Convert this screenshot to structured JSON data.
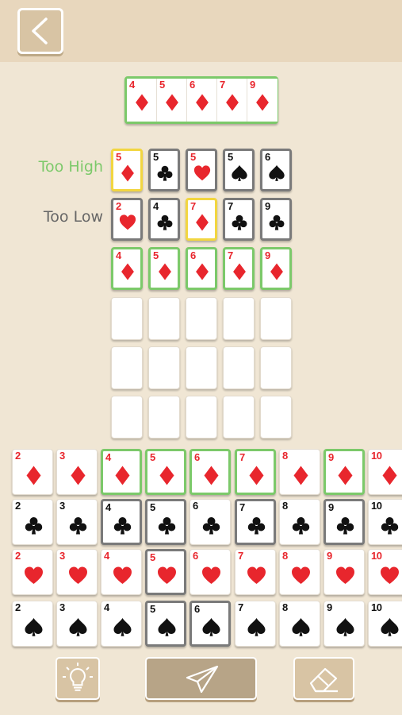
{
  "target": [
    {
      "rank": "4",
      "suit": "diamond"
    },
    {
      "rank": "5",
      "suit": "diamond"
    },
    {
      "rank": "6",
      "suit": "diamond"
    },
    {
      "rank": "7",
      "suit": "diamond"
    },
    {
      "rank": "9",
      "suit": "diamond"
    }
  ],
  "hints": [
    {
      "label": "Too High",
      "color": "#7cc96a"
    },
    {
      "label": "Too Low",
      "color": "#666666"
    }
  ],
  "guesses": [
    [
      {
        "rank": "5",
        "suit": "diamond",
        "mark": "yellow"
      },
      {
        "rank": "5",
        "suit": "club",
        "mark": "gray"
      },
      {
        "rank": "5",
        "suit": "heart",
        "mark": "gray"
      },
      {
        "rank": "5",
        "suit": "spade",
        "mark": "gray"
      },
      {
        "rank": "6",
        "suit": "spade",
        "mark": "gray"
      }
    ],
    [
      {
        "rank": "2",
        "suit": "heart",
        "mark": "gray"
      },
      {
        "rank": "4",
        "suit": "club",
        "mark": "gray"
      },
      {
        "rank": "7",
        "suit": "diamond",
        "mark": "yellow"
      },
      {
        "rank": "7",
        "suit": "club",
        "mark": "gray"
      },
      {
        "rank": "9",
        "suit": "club",
        "mark": "gray"
      }
    ],
    [
      {
        "rank": "4",
        "suit": "diamond",
        "mark": "green"
      },
      {
        "rank": "5",
        "suit": "diamond",
        "mark": "green"
      },
      {
        "rank": "6",
        "suit": "diamond",
        "mark": "green"
      },
      {
        "rank": "7",
        "suit": "diamond",
        "mark": "green"
      },
      {
        "rank": "9",
        "suit": "diamond",
        "mark": "green"
      }
    ]
  ],
  "empty_rows": 3,
  "keyboard": [
    {
      "suit": "diamond",
      "cards": [
        {
          "rank": "2",
          "mark": "none"
        },
        {
          "rank": "3",
          "mark": "none"
        },
        {
          "rank": "4",
          "mark": "green"
        },
        {
          "rank": "5",
          "mark": "green"
        },
        {
          "rank": "6",
          "mark": "green"
        },
        {
          "rank": "7",
          "mark": "green"
        },
        {
          "rank": "8",
          "mark": "none"
        },
        {
          "rank": "9",
          "mark": "green"
        },
        {
          "rank": "10",
          "mark": "none"
        }
      ]
    },
    {
      "suit": "club",
      "cards": [
        {
          "rank": "2",
          "mark": "none"
        },
        {
          "rank": "3",
          "mark": "none"
        },
        {
          "rank": "4",
          "mark": "gray"
        },
        {
          "rank": "5",
          "mark": "gray"
        },
        {
          "rank": "6",
          "mark": "none"
        },
        {
          "rank": "7",
          "mark": "gray"
        },
        {
          "rank": "8",
          "mark": "none"
        },
        {
          "rank": "9",
          "mark": "gray"
        },
        {
          "rank": "10",
          "mark": "none"
        }
      ]
    },
    {
      "suit": "heart",
      "cards": [
        {
          "rank": "2",
          "mark": "none"
        },
        {
          "rank": "3",
          "mark": "none"
        },
        {
          "rank": "4",
          "mark": "none"
        },
        {
          "rank": "5",
          "mark": "gray"
        },
        {
          "rank": "6",
          "mark": "none"
        },
        {
          "rank": "7",
          "mark": "none"
        },
        {
          "rank": "8",
          "mark": "none"
        },
        {
          "rank": "9",
          "mark": "none"
        },
        {
          "rank": "10",
          "mark": "none"
        }
      ]
    },
    {
      "suit": "spade",
      "cards": [
        {
          "rank": "2",
          "mark": "none"
        },
        {
          "rank": "3",
          "mark": "none"
        },
        {
          "rank": "4",
          "mark": "none"
        },
        {
          "rank": "5",
          "mark": "gray"
        },
        {
          "rank": "6",
          "mark": "gray"
        },
        {
          "rank": "7",
          "mark": "none"
        },
        {
          "rank": "8",
          "mark": "none"
        },
        {
          "rank": "9",
          "mark": "none"
        },
        {
          "rank": "10",
          "mark": "none"
        }
      ]
    }
  ],
  "colors": {
    "red": "#e8262d",
    "black": "#111111",
    "green": "#7cc96a",
    "yellow": "#f2d640",
    "gray": "#7a7a7a",
    "background": "#f0e6d4",
    "header": "#e8d7bd",
    "button": "#d8c4a4",
    "submit": "#b7a487"
  },
  "icons": {
    "back": "chevron-left-icon",
    "hint": "lightbulb-icon",
    "submit": "paper-plane-icon",
    "erase": "eraser-icon"
  }
}
